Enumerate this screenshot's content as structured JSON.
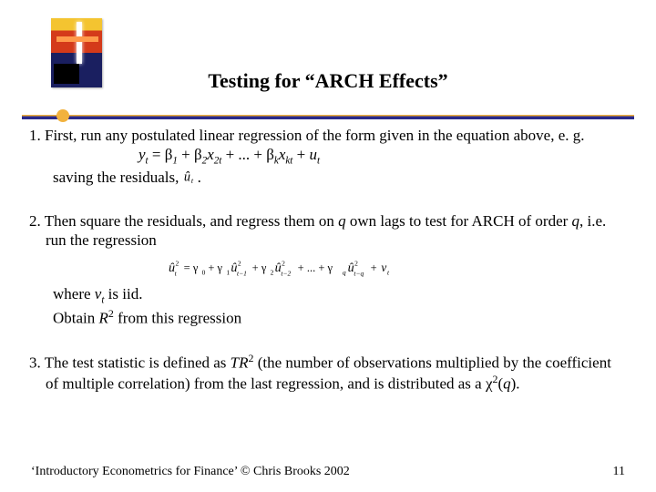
{
  "title": "Testing for “ARCH Effects”",
  "items": [
    {
      "num": "1.",
      "lead": "First, run any postulated linear regression of the form given in the equation above,  e. g.",
      "equation_plain": "y_t = β_1 + β_2 x_{2t} + ... + β_k x_{kt} + u_t",
      "tail_prefix": "saving the residuals, ",
      "uhat_inline": "û_t",
      "tail_suffix": "."
    },
    {
      "num": "2.",
      "lead_part1": "Then square the residuals, and regress them on ",
      "q1": "q",
      "lead_part2": " own lags to test for ARCH of order ",
      "q2": "q",
      "lead_part3": ", i.e. run the regression",
      "equation_plain": "û_t^2 = γ_0 + γ_1 û_{t-1}^2 + γ_2 û_{t-2}^2 + ... + γ_q û_{t-q}^2 + v_t",
      "where_prefix": "where ",
      "vt": "v",
      "vt_sub": "t",
      "where_suffix": " is iid.",
      "obtain_prefix": "Obtain ",
      "r2": "R",
      "r2_sup": "2",
      "obtain_suffix": " from this regression"
    },
    {
      "num": "3.",
      "lead_part1": "The test statistic is defined as ",
      "tr": "TR",
      "tr_sup": "2",
      "lead_part2": " (the number of observations multiplied by the coefficient of multiple correlation) from the last regression, and is distributed as a ",
      "chi": "χ",
      "chi_sup": "2",
      "chi_arg_open": "(",
      "chi_arg": "q",
      "chi_arg_close": ")."
    }
  ],
  "footer": {
    "text": "‘Introductory Econometrics for Finance’ © Chris Brooks 2002",
    "page": "11"
  }
}
